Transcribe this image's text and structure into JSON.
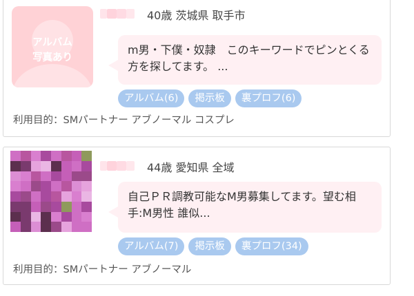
{
  "colors": {
    "card_border": "#d8d8d8",
    "bubble_bg": "#fff0f3",
    "tag_bg": "#a9c9ef",
    "placeholder_bg": "#ffd2d6"
  },
  "profiles": [
    {
      "avatar_placeholder": "アルバム\n写真あり",
      "age": "40歳",
      "location": "茨城県 取手市",
      "message": "m男・下僕・奴隷　このキーワードでピンとくる方を探してます。 ...",
      "tags": [
        "アルバム(6)",
        "掲示板",
        "裏プロフ(6)"
      ],
      "purpose": "利用目的：SMパートナー  アブノーマル  コスプレ"
    },
    {
      "age": "44歳",
      "location": "愛知県 全域",
      "message": "自己ＰＲ調教可能なM男募集してます。望む相手:M男性 誰似...",
      "tags": [
        "アルバム(7)",
        "掲示板",
        "裏プロフ(34)"
      ],
      "purpose": "利用目的：SMパートナー  アブノーマル"
    }
  ]
}
